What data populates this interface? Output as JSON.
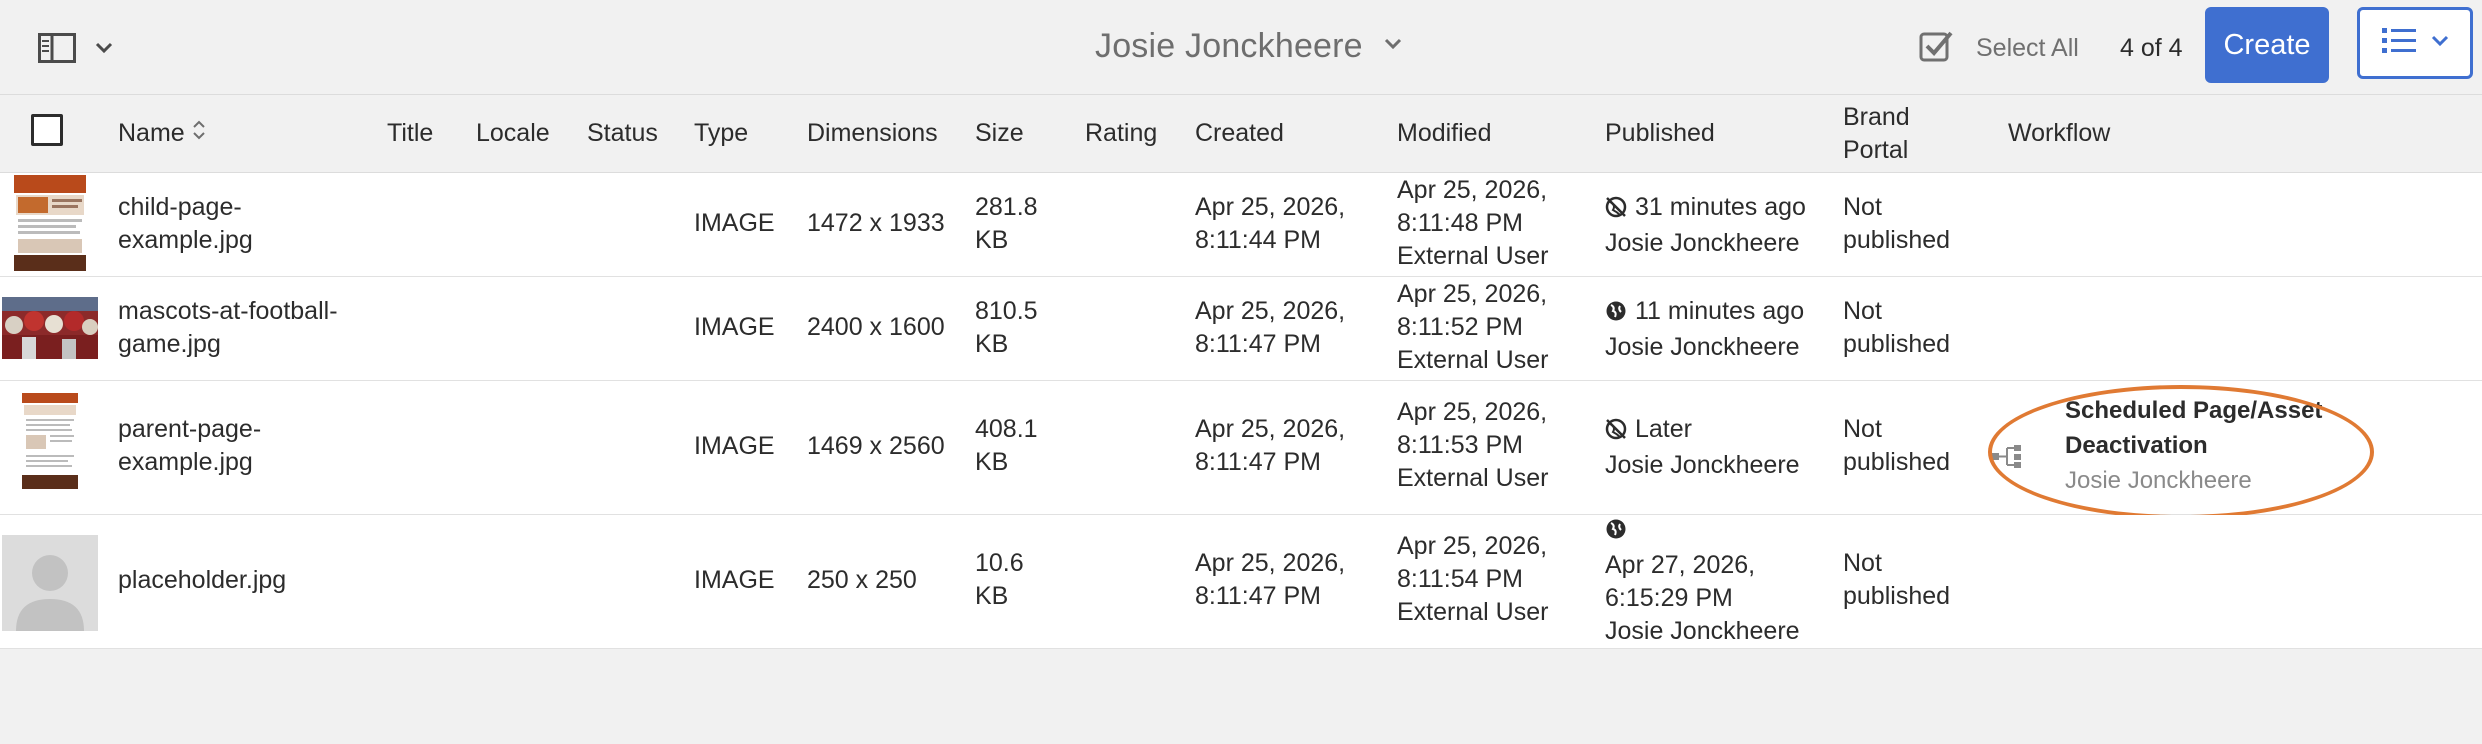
{
  "header": {
    "title": "Josie Jonckheere",
    "select_all_label": "Select All",
    "count": "4 of 4",
    "create_label": "Create"
  },
  "columns": {
    "name": "Name",
    "title": "Title",
    "locale": "Locale",
    "status": "Status",
    "type": "Type",
    "dimensions": "Dimensions",
    "size": "Size",
    "rating": "Rating",
    "created": "Created",
    "modified": "Modified",
    "published": "Published",
    "brand_portal_1": "Brand",
    "brand_portal_2": "Portal",
    "workflow": "Workflow"
  },
  "rows": [
    {
      "name_1": "child-page-",
      "name_2": "example.jpg",
      "type": "IMAGE",
      "dimensions": "1472 x 1933",
      "size_1": "281.8",
      "size_2": "KB",
      "created_1": "Apr 25, 2026,",
      "created_2": "8:11:44 PM",
      "modified_1": "Apr 25, 2026,",
      "modified_2": "8:11:48 PM",
      "modified_3": "External User",
      "published_icon": "unpublished-icon",
      "published_1": "31 minutes ago",
      "published_2": "Josie Jonckheere",
      "brand_1": "Not",
      "brand_2": "published"
    },
    {
      "name_1": "mascots-at-football-",
      "name_2": "game.jpg",
      "type": "IMAGE",
      "dimensions": "2400 x 1600",
      "size_1": "810.5",
      "size_2": "KB",
      "created_1": "Apr 25, 2026,",
      "created_2": "8:11:47 PM",
      "modified_1": "Apr 25, 2026,",
      "modified_2": "8:11:52 PM",
      "modified_3": "External User",
      "published_icon": "globe-icon",
      "published_1": "11 minutes ago",
      "published_2": "Josie Jonckheere",
      "brand_1": "Not",
      "brand_2": "published"
    },
    {
      "name_1": "parent-page-",
      "name_2": "example.jpg",
      "type": "IMAGE",
      "dimensions": "1469 x 2560",
      "size_1": "408.1",
      "size_2": "KB",
      "created_1": "Apr 25, 2026,",
      "created_2": "8:11:47 PM",
      "modified_1": "Apr 25, 2026,",
      "modified_2": "8:11:53 PM",
      "modified_3": "External User",
      "published_icon": "unpublished-icon",
      "published_1": "Later",
      "published_2": "Josie Jonckheere",
      "brand_1": "Not",
      "brand_2": "published",
      "workflow_title_1": "Scheduled Page/Asset",
      "workflow_title_2": "Deactivation",
      "workflow_user": "Josie Jonckheere",
      "workflow_icon": "workflow-icon"
    },
    {
      "name_1": "placeholder.jpg",
      "type": "IMAGE",
      "dimensions": "250 x 250",
      "size_1": "10.6",
      "size_2": "KB",
      "created_1": "Apr 25, 2026,",
      "created_2": "8:11:47 PM",
      "modified_1": "Apr 25, 2026,",
      "modified_2": "8:11:54 PM",
      "modified_3": "External User",
      "published_icon": "globe-icon",
      "published_1": "Apr 27, 2026,",
      "published_2": "6:15:29 PM",
      "published_3": "Josie Jonckheere",
      "brand_1": "Not",
      "brand_2": "published"
    }
  ],
  "colors": {
    "accent": "#3f6fd0",
    "highlight": "#e07a33",
    "background": "#f1f1f1"
  }
}
